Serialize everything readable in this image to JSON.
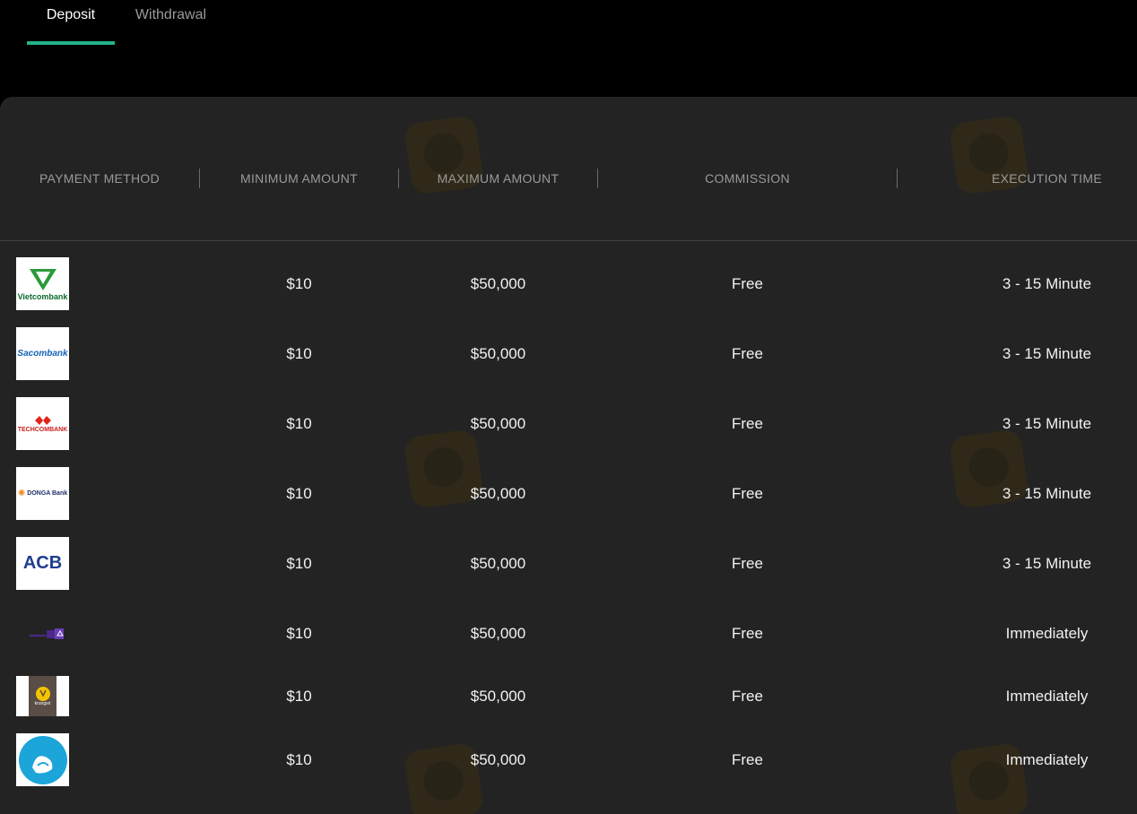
{
  "tabs": [
    {
      "label": "Deposit",
      "active": true
    },
    {
      "label": "Withdrawal",
      "active": false
    }
  ],
  "accent_color": "#22b38a",
  "table": {
    "headers": [
      "PAYMENT METHOD",
      "MINIMUM AMOUNT",
      "MAXIMUM AMOUNT",
      "COMMISSION",
      "EXECUTION TIME"
    ],
    "rows": [
      {
        "logo": "vietcombank-logo",
        "logo_text": "Vietcombank",
        "min": "$10",
        "max": "$50,000",
        "commission": "Free",
        "time": "3 - 15 Minute"
      },
      {
        "logo": "sacombank-logo",
        "logo_text": "Sacombank",
        "min": "$10",
        "max": "$50,000",
        "commission": "Free",
        "time": "3 - 15 Minute"
      },
      {
        "logo": "techcombank-logo",
        "logo_text": "TECHCOMBANK",
        "min": "$10",
        "max": "$50,000",
        "commission": "Free",
        "time": "3 - 15 Minute"
      },
      {
        "logo": "donga-bank-logo",
        "logo_text": "DONGA Bank",
        "min": "$10",
        "max": "$50,000",
        "commission": "Free",
        "time": "3 - 15 Minute"
      },
      {
        "logo": "acb-logo",
        "logo_text": "ACB",
        "min": "$10",
        "max": "$50,000",
        "commission": "Free",
        "time": "3 - 15 Minute"
      },
      {
        "logo": "scb-logo",
        "logo_text": "",
        "min": "$10",
        "max": "$50,000",
        "commission": "Free",
        "time": "Immediately"
      },
      {
        "logo": "krungsri-logo",
        "logo_text": "krungsri",
        "min": "$10",
        "max": "$50,000",
        "commission": "Free",
        "time": "Immediately"
      },
      {
        "logo": "krungthai-logo",
        "logo_text": "",
        "min": "$10",
        "max": "$50,000",
        "commission": "Free",
        "time": "Immediately"
      }
    ]
  }
}
